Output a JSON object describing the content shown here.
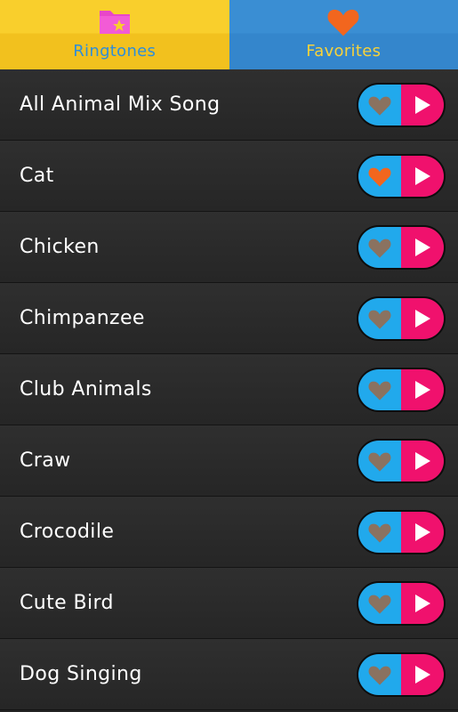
{
  "tabs": {
    "ringtones": {
      "label": "Ringtones",
      "icon": "folder-star-icon"
    },
    "favorites": {
      "label": "Favorites",
      "icon": "heart-icon"
    }
  },
  "colors": {
    "heart_inactive": "#8a7260",
    "heart_active": "#f2661e",
    "play_bg": "#f0116d",
    "fav_bg": "#21a9ec"
  },
  "ringtones": [
    {
      "name": "All Animal Mix Song",
      "favorite": false
    },
    {
      "name": "Cat",
      "favorite": true
    },
    {
      "name": "Chicken",
      "favorite": false
    },
    {
      "name": "Chimpanzee",
      "favorite": false
    },
    {
      "name": "Club Animals",
      "favorite": false
    },
    {
      "name": "Craw",
      "favorite": false
    },
    {
      "name": "Crocodile",
      "favorite": false
    },
    {
      "name": "Cute Bird",
      "favorite": false
    },
    {
      "name": "Dog Singing",
      "favorite": false
    }
  ]
}
